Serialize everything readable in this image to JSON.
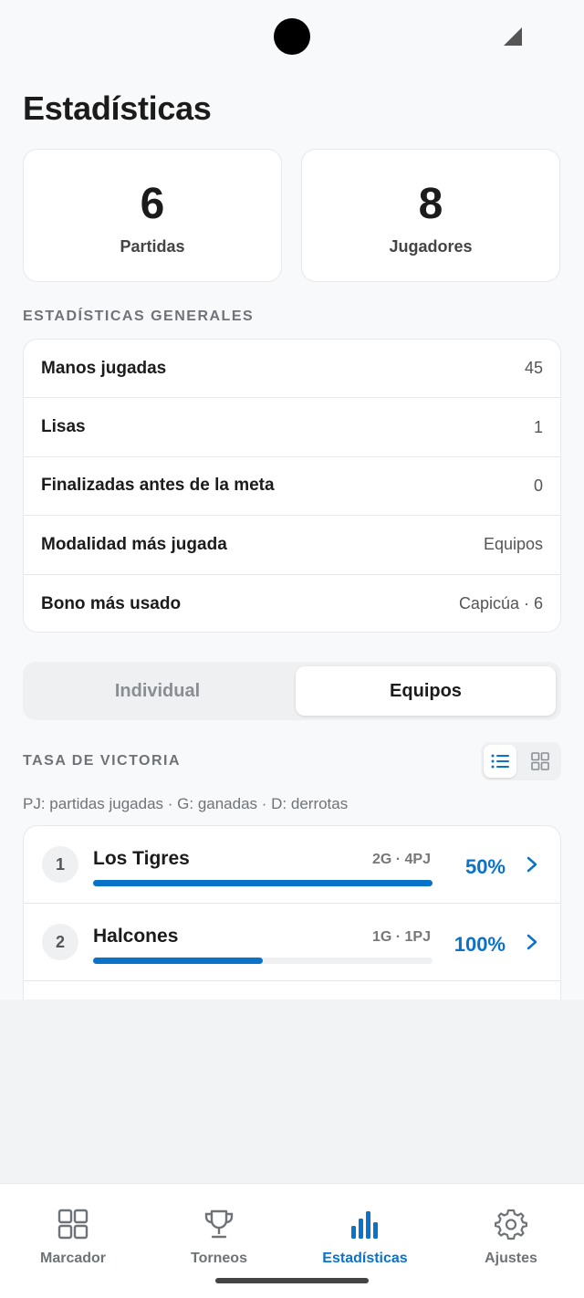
{
  "page": {
    "title": "Estadísticas"
  },
  "summary": [
    {
      "value": "6",
      "label": "Partidas"
    },
    {
      "value": "8",
      "label": "Jugadores"
    }
  ],
  "general": {
    "section_label": "ESTADÍSTICAS GENERALES",
    "rows": [
      {
        "label": "Manos jugadas",
        "value": "45"
      },
      {
        "label": "Lisas",
        "value": "1"
      },
      {
        "label": "Finalizadas antes de la meta",
        "value": "0"
      },
      {
        "label": "Modalidad más jugada",
        "value": "Equipos"
      },
      {
        "label": "Bono más usado",
        "value": "Capicúa · 6"
      }
    ]
  },
  "mode_toggle": {
    "options": [
      "Individual",
      "Equipos"
    ],
    "selected": "Equipos"
  },
  "win_rate": {
    "section_label": "TASA DE VICTORIA",
    "view": "list",
    "legend": "PJ: partidas jugadas · G: ganadas · D: derrotas",
    "rows": [
      {
        "rank": "1",
        "name": "Los Tigres",
        "record": "2G · 4PJ",
        "pct": "50%",
        "bar_fill": 1.0
      },
      {
        "rank": "2",
        "name": "Halcones",
        "record": "1G · 1PJ",
        "pct": "100%",
        "bar_fill": 0.5
      }
    ]
  },
  "bottom_nav": {
    "items": [
      {
        "label": "Marcador",
        "icon": "grid-icon"
      },
      {
        "label": "Torneos",
        "icon": "trophy-icon"
      },
      {
        "label": "Estadísticas",
        "icon": "bar-chart-icon"
      },
      {
        "label": "Ajustes",
        "icon": "gear-icon"
      }
    ],
    "active": "Estadísticas"
  },
  "colors": {
    "accent": "#0b72c9",
    "background": "#f8f9fa",
    "card": "#ffffff",
    "muted_text": "#6f7378"
  }
}
